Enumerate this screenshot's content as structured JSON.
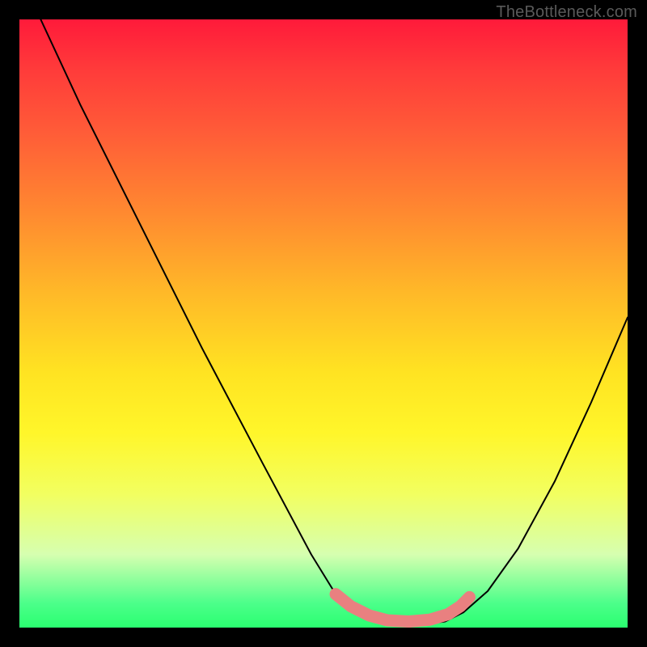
{
  "watermark": "TheBottleneck.com",
  "chart_data": {
    "type": "line",
    "title": "",
    "xlabel": "",
    "ylabel": "",
    "xlim": [
      0,
      1
    ],
    "ylim": [
      0,
      1
    ],
    "series": [
      {
        "name": "curve",
        "points": [
          {
            "x": 0.035,
            "y": 1.0
          },
          {
            "x": 0.1,
            "y": 0.86
          },
          {
            "x": 0.2,
            "y": 0.66
          },
          {
            "x": 0.3,
            "y": 0.46
          },
          {
            "x": 0.4,
            "y": 0.27
          },
          {
            "x": 0.48,
            "y": 0.12
          },
          {
            "x": 0.52,
            "y": 0.055
          },
          {
            "x": 0.55,
            "y": 0.028
          },
          {
            "x": 0.58,
            "y": 0.012
          },
          {
            "x": 0.62,
            "y": 0.005
          },
          {
            "x": 0.66,
            "y": 0.005
          },
          {
            "x": 0.7,
            "y": 0.01
          },
          {
            "x": 0.73,
            "y": 0.025
          },
          {
            "x": 0.77,
            "y": 0.06
          },
          {
            "x": 0.82,
            "y": 0.13
          },
          {
            "x": 0.88,
            "y": 0.24
          },
          {
            "x": 0.94,
            "y": 0.37
          },
          {
            "x": 1.0,
            "y": 0.51
          }
        ]
      },
      {
        "name": "highlight",
        "color": "#e98080",
        "thickness_px": 15,
        "points": [
          {
            "x": 0.52,
            "y": 0.055
          },
          {
            "x": 0.545,
            "y": 0.035
          },
          {
            "x": 0.575,
            "y": 0.02
          },
          {
            "x": 0.605,
            "y": 0.012
          },
          {
            "x": 0.64,
            "y": 0.01
          },
          {
            "x": 0.675,
            "y": 0.013
          },
          {
            "x": 0.705,
            "y": 0.022
          },
          {
            "x": 0.725,
            "y": 0.035
          },
          {
            "x": 0.74,
            "y": 0.05
          }
        ]
      }
    ]
  }
}
